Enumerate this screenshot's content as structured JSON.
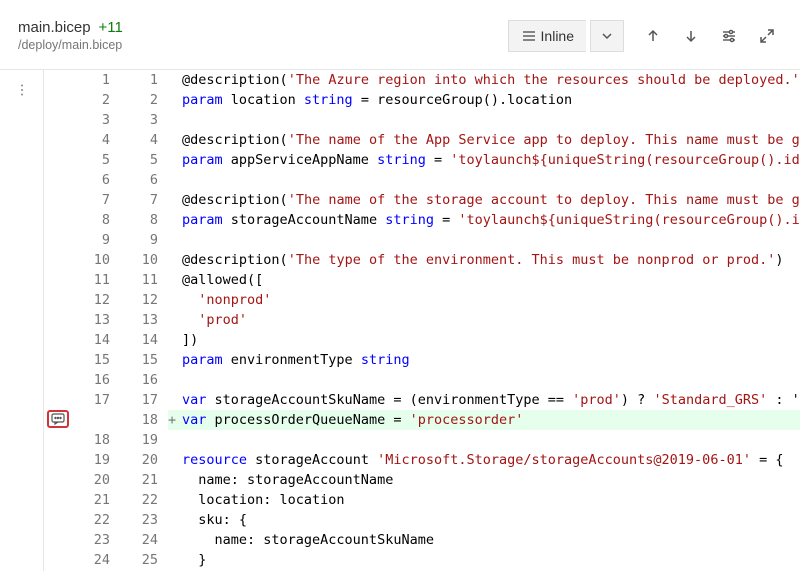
{
  "header": {
    "file_name": "main.bicep",
    "change_count": "+11",
    "file_path": "/deploy/main.bicep",
    "view_mode_label": "Inline"
  },
  "code": {
    "rows": [
      {
        "old": "1",
        "new": "1",
        "sign": "",
        "tokens": [
          [
            "fn",
            "@description"
          ],
          [
            "op",
            "("
          ],
          [
            "str",
            "'The Azure region into which the resources should be deployed.'"
          ]
        ]
      },
      {
        "old": "2",
        "new": "2",
        "sign": "",
        "tokens": [
          [
            "kw",
            "param"
          ],
          [
            "plain",
            " location "
          ],
          [
            "kw",
            "string"
          ],
          [
            "plain",
            " = resourceGroup().location"
          ]
        ]
      },
      {
        "old": "3",
        "new": "3",
        "sign": "",
        "tokens": []
      },
      {
        "old": "4",
        "new": "4",
        "sign": "",
        "tokens": [
          [
            "fn",
            "@description"
          ],
          [
            "op",
            "("
          ],
          [
            "str",
            "'The name of the App Service app to deploy. This name must be g"
          ]
        ]
      },
      {
        "old": "5",
        "new": "5",
        "sign": "",
        "tokens": [
          [
            "kw",
            "param"
          ],
          [
            "plain",
            " appServiceAppName "
          ],
          [
            "kw",
            "string"
          ],
          [
            "plain",
            " = "
          ],
          [
            "str",
            "'toylaunch${uniqueString(resourceGroup().id"
          ]
        ]
      },
      {
        "old": "6",
        "new": "6",
        "sign": "",
        "tokens": []
      },
      {
        "old": "7",
        "new": "7",
        "sign": "",
        "tokens": [
          [
            "fn",
            "@description"
          ],
          [
            "op",
            "("
          ],
          [
            "str",
            "'The name of the storage account to deploy. This name must be g"
          ]
        ]
      },
      {
        "old": "8",
        "new": "8",
        "sign": "",
        "tokens": [
          [
            "kw",
            "param"
          ],
          [
            "plain",
            " storageAccountName "
          ],
          [
            "kw",
            "string"
          ],
          [
            "plain",
            " = "
          ],
          [
            "str",
            "'toylaunch${uniqueString(resourceGroup().i"
          ]
        ]
      },
      {
        "old": "9",
        "new": "9",
        "sign": "",
        "tokens": []
      },
      {
        "old": "10",
        "new": "10",
        "sign": "",
        "tokens": [
          [
            "fn",
            "@description"
          ],
          [
            "op",
            "("
          ],
          [
            "str",
            "'The type of the environment. This must be nonprod or prod.'"
          ],
          [
            "op",
            ")"
          ]
        ]
      },
      {
        "old": "11",
        "new": "11",
        "sign": "",
        "tokens": [
          [
            "fn",
            "@allowed"
          ],
          [
            "op",
            "(["
          ]
        ]
      },
      {
        "old": "12",
        "new": "12",
        "sign": "",
        "tokens": [
          [
            "plain",
            "  "
          ],
          [
            "str",
            "'nonprod'"
          ]
        ]
      },
      {
        "old": "13",
        "new": "13",
        "sign": "",
        "tokens": [
          [
            "plain",
            "  "
          ],
          [
            "str",
            "'prod'"
          ]
        ]
      },
      {
        "old": "14",
        "new": "14",
        "sign": "",
        "tokens": [
          [
            "op",
            "])"
          ]
        ]
      },
      {
        "old": "15",
        "new": "15",
        "sign": "",
        "tokens": [
          [
            "kw",
            "param"
          ],
          [
            "plain",
            " environmentType "
          ],
          [
            "kw",
            "string"
          ]
        ]
      },
      {
        "old": "16",
        "new": "16",
        "sign": "",
        "tokens": []
      },
      {
        "old": "17",
        "new": "17",
        "sign": "",
        "tokens": [
          [
            "kw",
            "var"
          ],
          [
            "plain",
            " storageAccountSkuName = (environmentType == "
          ],
          [
            "str",
            "'prod'"
          ],
          [
            "plain",
            ") ? "
          ],
          [
            "str",
            "'Standard_GRS'"
          ],
          [
            "plain",
            " : '"
          ]
        ]
      },
      {
        "old": "",
        "new": "18",
        "sign": "+",
        "added": true,
        "comment": true,
        "tokens": [
          [
            "kw",
            "var"
          ],
          [
            "plain",
            " processOrderQueueName = "
          ],
          [
            "str",
            "'processorder'"
          ]
        ]
      },
      {
        "old": "18",
        "new": "19",
        "sign": "",
        "tokens": []
      },
      {
        "old": "19",
        "new": "20",
        "sign": "",
        "tokens": [
          [
            "kw",
            "resource"
          ],
          [
            "plain",
            " storageAccount "
          ],
          [
            "str",
            "'Microsoft.Storage/storageAccounts@2019-06-01'"
          ],
          [
            "plain",
            " = {"
          ]
        ]
      },
      {
        "old": "20",
        "new": "21",
        "sign": "",
        "tokens": [
          [
            "plain",
            "  name: storageAccountName"
          ]
        ]
      },
      {
        "old": "21",
        "new": "22",
        "sign": "",
        "tokens": [
          [
            "plain",
            "  location: location"
          ]
        ]
      },
      {
        "old": "22",
        "new": "23",
        "sign": "",
        "tokens": [
          [
            "plain",
            "  sku: {"
          ]
        ]
      },
      {
        "old": "23",
        "new": "24",
        "sign": "",
        "tokens": [
          [
            "plain",
            "    name: storageAccountSkuName"
          ]
        ]
      },
      {
        "old": "24",
        "new": "25",
        "sign": "",
        "tokens": [
          [
            "plain",
            "  }"
          ]
        ]
      }
    ]
  }
}
